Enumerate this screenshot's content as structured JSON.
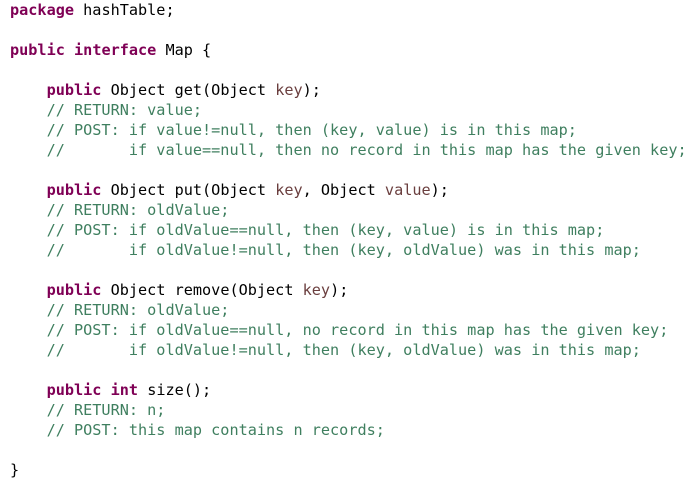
{
  "editor": {
    "language": "java",
    "colors": {
      "keyword": "#7f0055",
      "parameter": "#6a3e3e",
      "comment": "#3f7f5f",
      "text": "#000000",
      "background": "#ffffff"
    },
    "lines": [
      [
        {
          "t": "package",
          "c": "kw"
        },
        {
          "t": " hashTable;"
        }
      ],
      [],
      [
        {
          "t": "public",
          "c": "kw"
        },
        {
          "t": " "
        },
        {
          "t": "interface",
          "c": "kw"
        },
        {
          "t": " Map {"
        }
      ],
      [],
      [
        {
          "t": "    "
        },
        {
          "t": "public",
          "c": "kw"
        },
        {
          "t": " Object get(Object "
        },
        {
          "t": "key",
          "c": "param"
        },
        {
          "t": ");"
        }
      ],
      [
        {
          "t": "    // RETURN: value;",
          "c": "cm"
        }
      ],
      [
        {
          "t": "    // POST: if value!=null, then (key, value) is in this map;",
          "c": "cm"
        }
      ],
      [
        {
          "t": "    //       if value==null, then no record in this map has the given key;",
          "c": "cm"
        }
      ],
      [],
      [
        {
          "t": "    "
        },
        {
          "t": "public",
          "c": "kw"
        },
        {
          "t": " Object put(Object "
        },
        {
          "t": "key",
          "c": "param"
        },
        {
          "t": ", Object "
        },
        {
          "t": "value",
          "c": "param"
        },
        {
          "t": ");"
        }
      ],
      [
        {
          "t": "    // RETURN: oldValue;",
          "c": "cm"
        }
      ],
      [
        {
          "t": "    // POST: if oldValue==null, then (key, value) is in this map;",
          "c": "cm"
        }
      ],
      [
        {
          "t": "    //       if oldValue!=null, then (key, oldValue) was in this map;",
          "c": "cm"
        }
      ],
      [],
      [
        {
          "t": "    "
        },
        {
          "t": "public",
          "c": "kw"
        },
        {
          "t": " Object remove(Object "
        },
        {
          "t": "key",
          "c": "param"
        },
        {
          "t": ");"
        }
      ],
      [
        {
          "t": "    // RETURN: oldValue;",
          "c": "cm"
        }
      ],
      [
        {
          "t": "    // POST: if oldValue==null, no record in this map has the given key;",
          "c": "cm"
        }
      ],
      [
        {
          "t": "    //       if oldValue!=null, then (key, oldValue) was in this map;",
          "c": "cm"
        }
      ],
      [],
      [
        {
          "t": "    "
        },
        {
          "t": "public",
          "c": "kw"
        },
        {
          "t": " "
        },
        {
          "t": "int",
          "c": "kw"
        },
        {
          "t": " size();"
        }
      ],
      [
        {
          "t": "    // RETURN: n;",
          "c": "cm"
        }
      ],
      [
        {
          "t": "    // POST: this map contains n records;",
          "c": "cm"
        }
      ],
      [],
      [
        {
          "t": "}"
        }
      ]
    ]
  }
}
